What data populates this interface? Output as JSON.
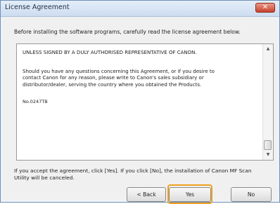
{
  "window": {
    "title": "License Agreement",
    "close_label": "✕"
  },
  "instruction": "Before installing the software programs, carefully read the license agreement below.",
  "license": {
    "heading": "UNLESS SIGNED BY A DULY AUTHORISED REPRESENTATIVE OF CANON.",
    "paragraph": "Should you have any questions concerning this Agreement, or if you desire to\ncontact Canon for any reason, please write to Canon's sales subsidiary or\ndistributor/dealer, serving the country where you obtained the Products.",
    "reference": "No.0247TB"
  },
  "scrollbar": {
    "up_arrow": "▲",
    "down_arrow": "▼"
  },
  "accept_text": "If you accept the agreement, click [Yes]. If you click [No], the installation of Canon MF Scan Utility will be canceled.",
  "buttons": {
    "back": "< Back",
    "yes": "Yes",
    "no": "No"
  },
  "colors": {
    "highlight": "#f0a020",
    "close_button": "#c9402a"
  }
}
